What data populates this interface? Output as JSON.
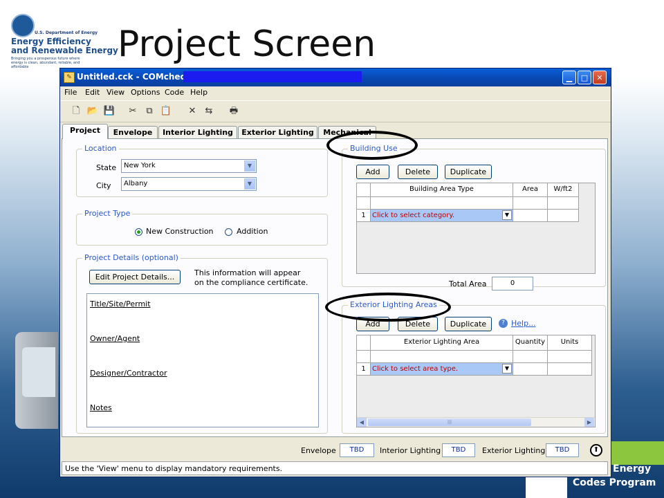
{
  "slide": {
    "title": "Project Screen",
    "logo": {
      "agency": "U.S. Department of Energy",
      "line1": "Energy Efficiency",
      "line2": "and Renewable Energy",
      "tagline": "Bringing you a prosperous future where energy is clean, abundant, reliable, and affordable"
    },
    "footer_logo": {
      "line1": "Energy",
      "line2": "Codes Program"
    }
  },
  "window": {
    "title": "Untitled.cck - COMcheck",
    "menu": [
      "File",
      "Edit",
      "View",
      "Options",
      "Code",
      "Help"
    ],
    "toolbar_icons": [
      "new-file-icon",
      "open-folder-icon",
      "save-icon",
      "cut-icon",
      "copy-icon",
      "paste-icon",
      "delete-icon",
      "insert-row-icon",
      "print-icon"
    ],
    "tabs": [
      "Project",
      "Envelope",
      "Interior Lighting",
      "Exterior Lighting",
      "Mechanical"
    ],
    "active_tab": "Project"
  },
  "location": {
    "title": "Location",
    "state_label": "State",
    "state_value": "New York",
    "city_label": "City",
    "city_value": "Albany"
  },
  "project_type": {
    "title": "Project Type",
    "options": [
      "New Construction",
      "Addition"
    ],
    "selected": "New Construction"
  },
  "project_details": {
    "title": "Project Details (optional)",
    "button": "Edit Project Details...",
    "note_line1": "This information will appear",
    "note_line2": "on the compliance certificate.",
    "fields": [
      "Title/Site/Permit",
      "Owner/Agent",
      "Designer/Contractor",
      "Notes"
    ]
  },
  "building_use": {
    "title": "Building Use",
    "buttons": [
      "Add",
      "Delete",
      "Duplicate"
    ],
    "columns": [
      "Building Area Type",
      "Area",
      "W/ft2"
    ],
    "row_number": "1",
    "row_placeholder": "Click to select category.",
    "total_label": "Total Area",
    "total_value": "0"
  },
  "exterior_lighting": {
    "title": "Exterior Lighting Areas",
    "buttons": [
      "Add",
      "Delete",
      "Duplicate"
    ],
    "help": "Help...",
    "columns": [
      "Exterior Lighting Area",
      "Quantity",
      "Units"
    ],
    "row_number": "1",
    "row_placeholder": "Click to select area type."
  },
  "compliance": {
    "envelope_label": "Envelope",
    "envelope_value": "TBD",
    "interior_label": "Interior Lighting",
    "interior_value": "TBD",
    "exterior_label": "Exterior Lighting",
    "exterior_value": "TBD"
  },
  "status_bar": "Use the 'View' menu to display mandatory requirements.",
  "colors": {
    "group_title": "#2a58c7",
    "selected_row": "#a9c8f5",
    "placeholder_text": "#c00000",
    "titlebar": "#0a5fd8"
  }
}
